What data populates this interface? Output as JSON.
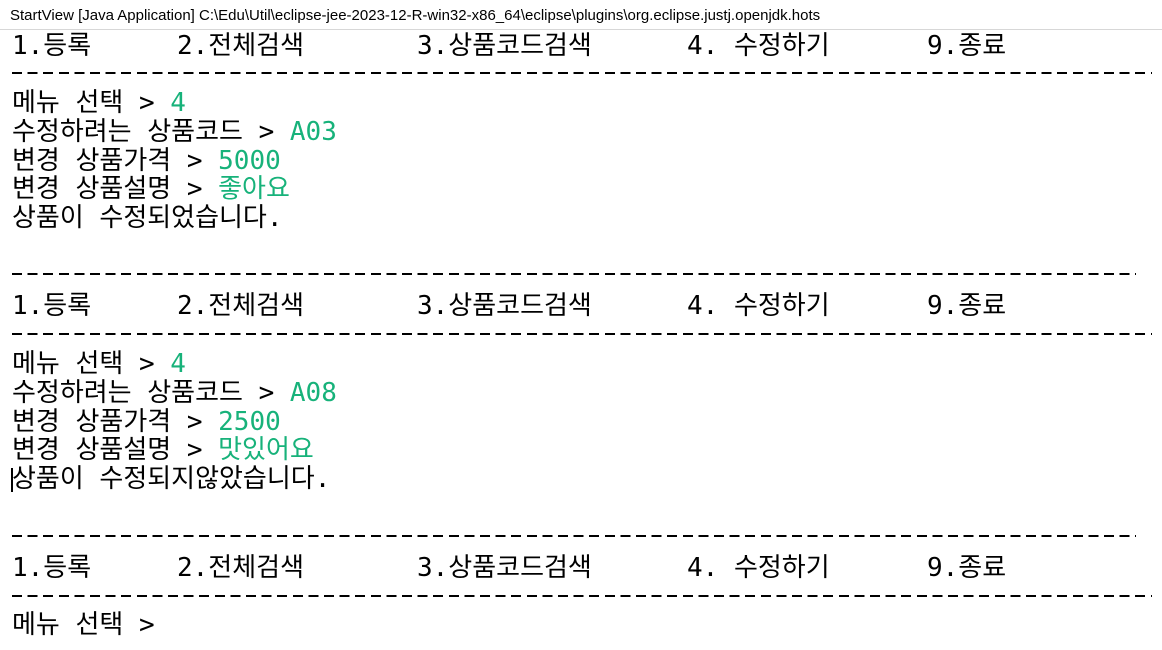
{
  "window": {
    "title": "StartView [Java Application] C:\\Edu\\Util\\eclipse-jee-2023-12-R-win32-x86_64\\eclipse\\plugins\\org.eclipse.justj.openjdk.hots"
  },
  "menu": {
    "register": "1.등록",
    "search_all": "2.전체검색",
    "search_code": "3.상품코드검색",
    "edit": "4. 수정하기",
    "exit": "9.종료"
  },
  "session1": {
    "menu_prompt": "메뉴 선택 > ",
    "menu_input": "4",
    "code_prompt": "수정하려는 상품코드 > ",
    "code_input": "A03",
    "price_prompt": "변경 상품가격 > ",
    "price_input": "5000",
    "desc_prompt": "변경 상품설명 > ",
    "desc_input": "좋아요",
    "result": "상품이 수정되었습니다."
  },
  "session2": {
    "menu_prompt": "메뉴 선택 > ",
    "menu_input": "4",
    "code_prompt": "수정하려는 상품코드 > ",
    "code_input": "A08",
    "price_prompt": "변경 상품가격 > ",
    "price_input": "2500",
    "desc_prompt": "변경 상품설명 > ",
    "desc_input": "맛있어요",
    "result": "상품이 수정되지않았습니다."
  },
  "session3": {
    "menu_prompt": "메뉴 선택 > "
  },
  "colors": {
    "user_input": "#17b27a",
    "console_text": "#000000"
  }
}
